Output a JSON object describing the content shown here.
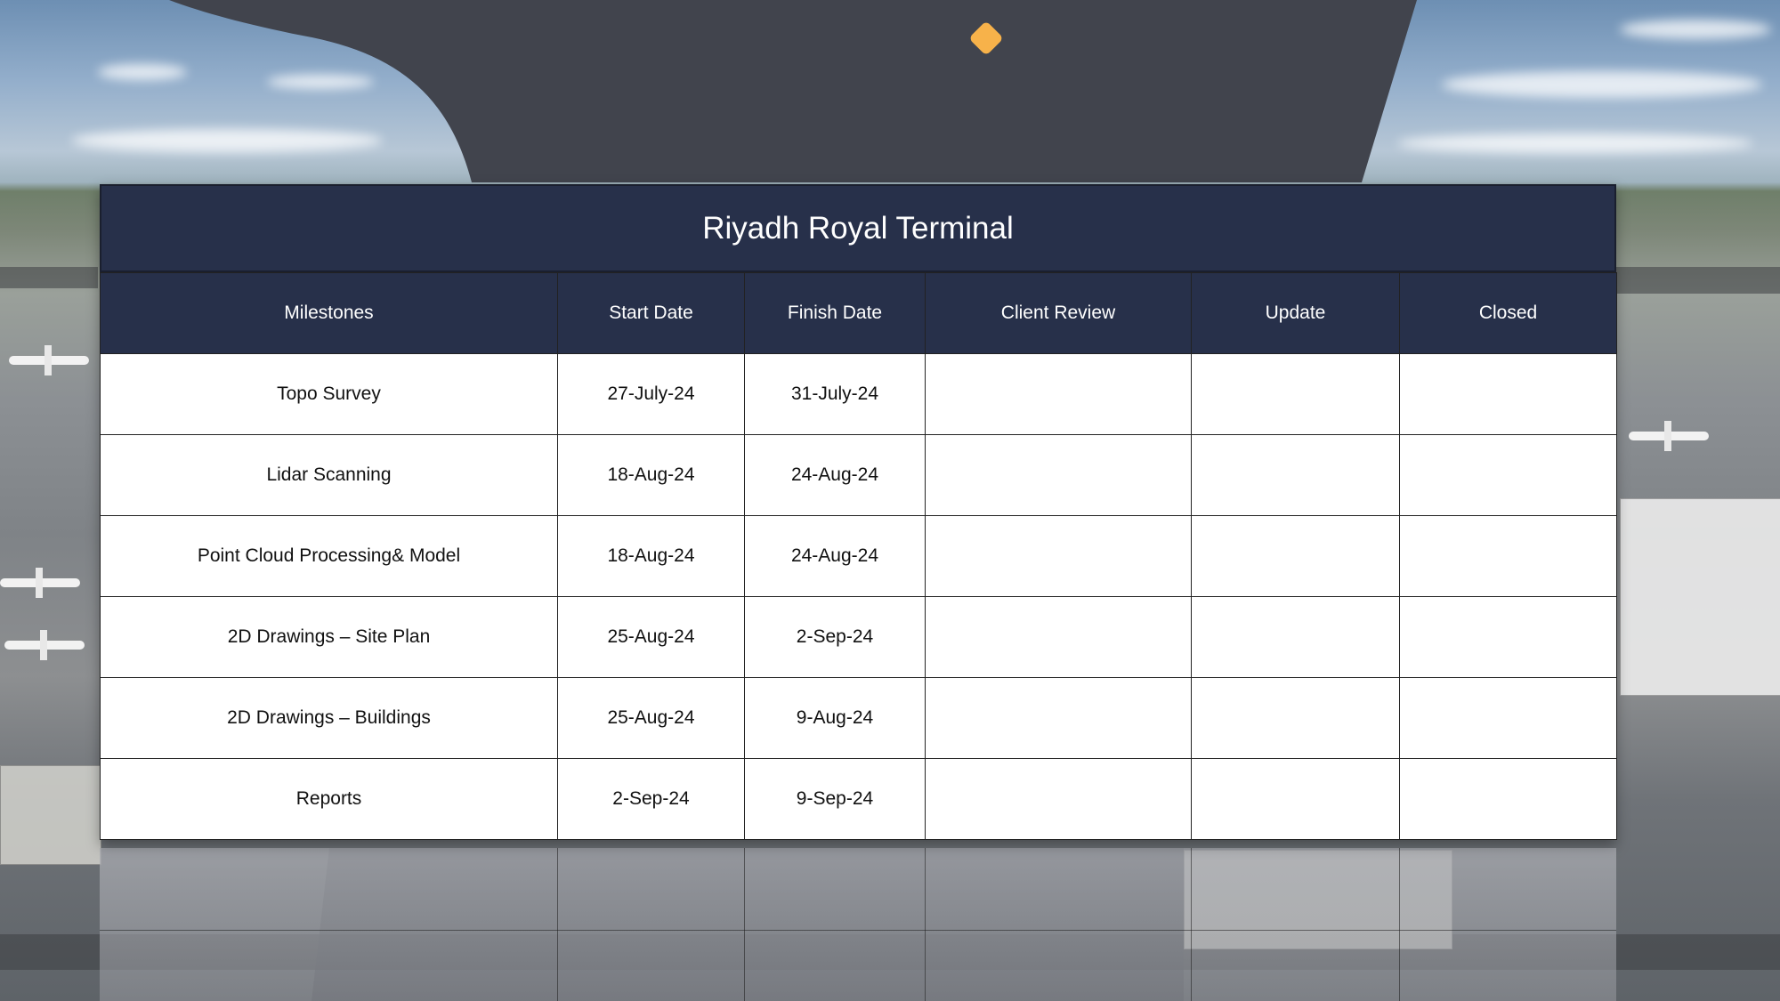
{
  "slide": {
    "title": "Riyadh Royal Terminal",
    "accent_color": "#f7b24a",
    "header_color": "#27304a",
    "tab_color": "#41444d"
  },
  "table": {
    "columns": [
      "Milestones",
      "Start Date",
      "Finish Date",
      "Client Review",
      "Update",
      "Closed"
    ],
    "rows": [
      {
        "milestone": "Topo Survey",
        "start": "27-July-24",
        "finish": "31-July-24",
        "client_review": "",
        "update": "",
        "closed": ""
      },
      {
        "milestone": "Lidar Scanning",
        "start": "18-Aug-24",
        "finish": "24-Aug-24",
        "client_review": "",
        "update": "",
        "closed": ""
      },
      {
        "milestone": "Point Cloud Processing& Model",
        "start": "18-Aug-24",
        "finish": "24-Aug-24",
        "client_review": "",
        "update": "",
        "closed": ""
      },
      {
        "milestone": "2D Drawings – Site Plan",
        "start": "25-Aug-24",
        "finish": "2-Sep-24",
        "client_review": "",
        "update": "",
        "closed": ""
      },
      {
        "milestone": "2D Drawings – Buildings",
        "start": "25-Aug-24",
        "finish": "9-Aug-24",
        "client_review": "",
        "update": "",
        "closed": ""
      },
      {
        "milestone": "Reports",
        "start": "2-Sep-24",
        "finish": "9-Sep-24",
        "client_review": "",
        "update": "",
        "closed": ""
      }
    ]
  }
}
